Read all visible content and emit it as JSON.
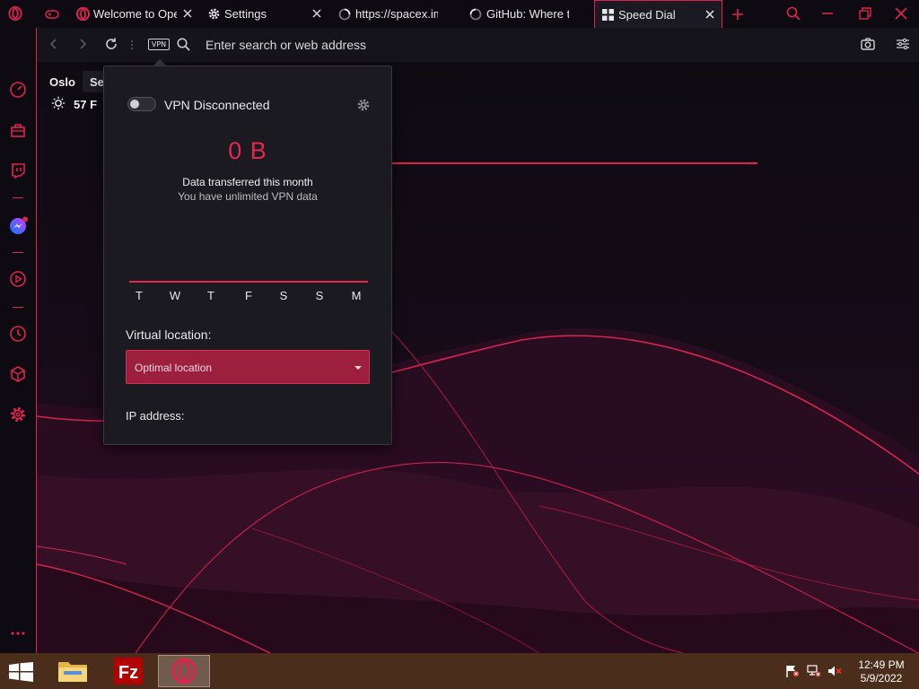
{
  "tabs": [
    {
      "title": "",
      "icon": "gamepad-icon"
    },
    {
      "title": "Welcome to Opera",
      "icon": "opera-icon"
    },
    {
      "title": "Settings",
      "icon": "gear-icon"
    },
    {
      "title": "https://spacex.im",
      "icon": "loading-spinner-icon"
    },
    {
      "title": "GitHub: Where th",
      "icon": "loading-spinner-icon"
    },
    {
      "title": "Speed Dial",
      "icon": "speed-dial-grid-icon",
      "active": true
    }
  ],
  "address": {
    "placeholder": "Enter search or web address",
    "vpn_badge": "VPN"
  },
  "weather": {
    "city": "Oslo",
    "temperature": "57 F",
    "tooltip": "Se"
  },
  "vpn": {
    "status": "VPN Disconnected",
    "enabled": false,
    "data_amount": "0 B",
    "data_caption": "Data transferred this month",
    "data_sub": "You have unlimited VPN data",
    "days": [
      "T",
      "W",
      "T",
      "F",
      "S",
      "S",
      "M"
    ],
    "virtual_location_label": "Virtual location:",
    "location_value": "Optimal location",
    "ip_label": "IP address:"
  },
  "taskbar": {
    "time": "12:49 PM",
    "date": "5/9/2022"
  },
  "colors": {
    "accent": "#e0224f",
    "select_bg": "#9c1f3d",
    "taskbar": "#4a2d1a"
  }
}
